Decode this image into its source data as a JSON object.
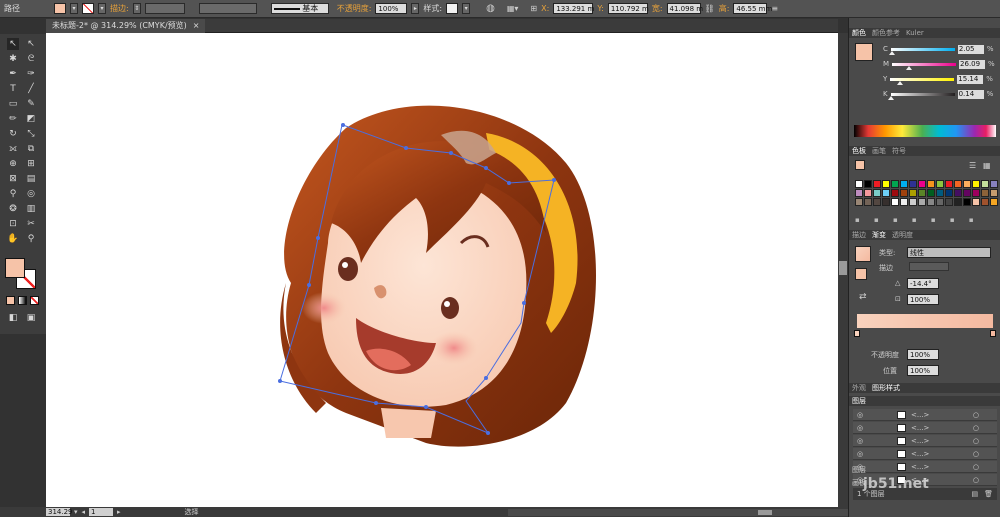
{
  "control_bar": {
    "mode_label": "路径",
    "stroke_label": "描边:",
    "stroke_style": "基本",
    "opacity_label": "不透明度:",
    "opacity_value": "100%",
    "style_label": "样式:",
    "x_label": "X:",
    "x_value": "133.291 m",
    "y_label": "Y:",
    "y_value": "110.792 m",
    "w_label": "宽:",
    "w_value": "41.098 m",
    "h_label": "高:",
    "h_value": "46.55 mm",
    "fill_color": "#f6c3a8"
  },
  "document_tab": {
    "title": "未标题-2* @ 314.29% (CMYK/预览)",
    "close": "×"
  },
  "status_bar": {
    "zoom": "314.29",
    "page": "1",
    "tool_status": "选择"
  },
  "color_panel": {
    "tabs": [
      "颜色",
      "颜色参考",
      "Kuler"
    ],
    "channels": [
      {
        "label": "C",
        "value": "2.05",
        "color": "#00aeef",
        "fraction": 0.02
      },
      {
        "label": "M",
        "value": "26.09",
        "color": "#ec008c",
        "fraction": 0.26
      },
      {
        "label": "Y",
        "value": "15.14",
        "color": "#fff200",
        "fraction": 0.15
      },
      {
        "label": "K",
        "value": "0.14",
        "color": "#231f20",
        "fraction": 0.01
      }
    ],
    "percent_sign": "%"
  },
  "swatches_panel": {
    "tabs": [
      "色板",
      "画笔",
      "符号"
    ],
    "colors": [
      "#ffffff",
      "#000000",
      "#ed1c24",
      "#ffff00",
      "#00a651",
      "#00aeef",
      "#2e3192",
      "#ec008c",
      "#f7941d",
      "#8dc63f",
      "#ed1c24",
      "#f26522",
      "#fbaf5d",
      "#fff200",
      "#c4df9b",
      "#8781bd",
      "#bd8cbf",
      "#f5989d",
      "#7accc8",
      "#6dcff6",
      "#9e0b0f",
      "#a0410d",
      "#aba000",
      "#598527",
      "#005e20",
      "#005b7f",
      "#003471",
      "#440e62",
      "#630460",
      "#9e005d",
      "#8c6239",
      "#c69c6d",
      "#998675",
      "#736357",
      "#534741",
      "#362f2d",
      "#ffffff",
      "#eeeeee",
      "#cccccc",
      "#aaaaaa",
      "#888888",
      "#666666",
      "#444444",
      "#222222",
      "#000000",
      "#f6c3a8",
      "#a0522d",
      "#f5a623"
    ]
  },
  "gradient_panel": {
    "tabs": [
      "描边",
      "渐变",
      "透明度"
    ],
    "type_label": "类型:",
    "type_value": "线性",
    "stroke_label": "描边",
    "angle_label": "△",
    "angle_value": "-14.4°",
    "ratio_label": "",
    "ratio_value": "100%",
    "opacity_label": "不透明度",
    "opacity_value": "100%",
    "position_label": "位置",
    "position_value": "100%",
    "color_start": "#f9d2bd",
    "color_end": "#f4b9a0"
  },
  "appearance_panel": {
    "tabs": [
      "外观",
      "图形样式"
    ]
  },
  "layers_panel": {
    "tabs": [
      "图层"
    ],
    "rows": [
      "<...>",
      "<...>",
      "<...>",
      "<...>",
      "<...>",
      "<...>"
    ],
    "footer": "1 个图层"
  },
  "side_tabs": {
    "layers_collapsed": "图层",
    "artboards_collapsed": "画板"
  },
  "watermark": "jb51.net"
}
